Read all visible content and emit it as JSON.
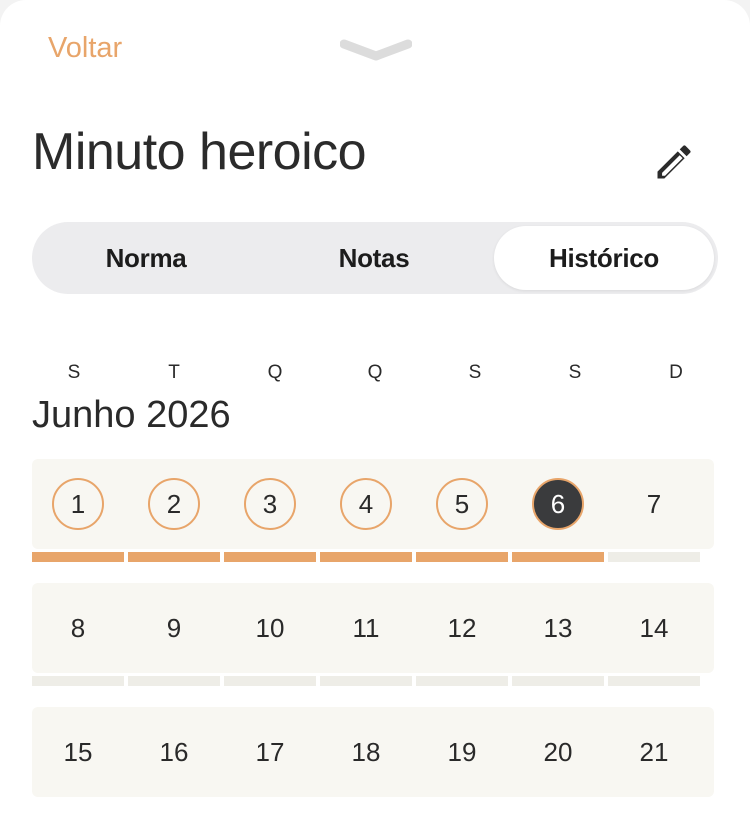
{
  "header": {
    "back_label": "Voltar",
    "title": "Minuto heroico"
  },
  "tabs": [
    {
      "label": "Norma",
      "active": false
    },
    {
      "label": "Notas",
      "active": false
    },
    {
      "label": "Histórico",
      "active": true
    }
  ],
  "calendar": {
    "weekdays": [
      "S",
      "T",
      "Q",
      "Q",
      "S",
      "S",
      "D"
    ],
    "month_label": "Junho 2026",
    "weeks": [
      {
        "days": [
          "1",
          "2",
          "3",
          "4",
          "5",
          "6",
          "7"
        ],
        "status": [
          "done",
          "done",
          "done",
          "done",
          "done",
          "today",
          "none"
        ]
      },
      {
        "days": [
          "8",
          "9",
          "10",
          "11",
          "12",
          "13",
          "14"
        ],
        "status": [
          "none",
          "none",
          "none",
          "none",
          "none",
          "none",
          "none"
        ]
      },
      {
        "days": [
          "15",
          "16",
          "17",
          "18",
          "19",
          "20",
          "21"
        ],
        "status": [
          "none",
          "none",
          "none",
          "none",
          "none",
          "none",
          "none"
        ]
      }
    ]
  },
  "colors": {
    "accent": "#e8a56a",
    "today": "#3a3b3d",
    "row_bg": "#f8f7f2"
  }
}
